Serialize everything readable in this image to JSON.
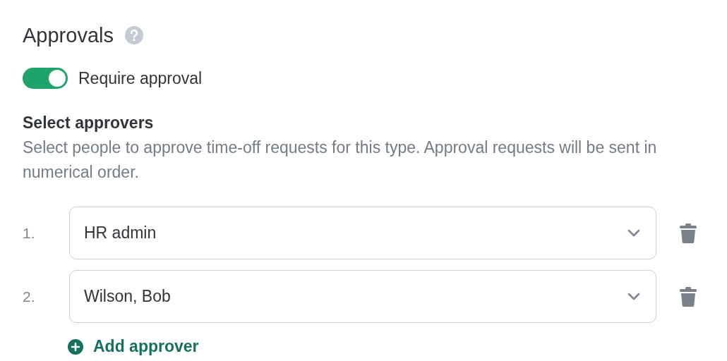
{
  "title": "Approvals",
  "require_approval": {
    "label": "Require approval",
    "on": true
  },
  "approvers_section": {
    "heading": "Select approvers",
    "description": "Select people to approve time-off requests for this type. Approval requests will be sent in numerical order."
  },
  "approvers": [
    {
      "number": "1.",
      "value": "HR admin"
    },
    {
      "number": "2.",
      "value": "Wilson, Bob"
    }
  ],
  "add_button": "Add approver"
}
